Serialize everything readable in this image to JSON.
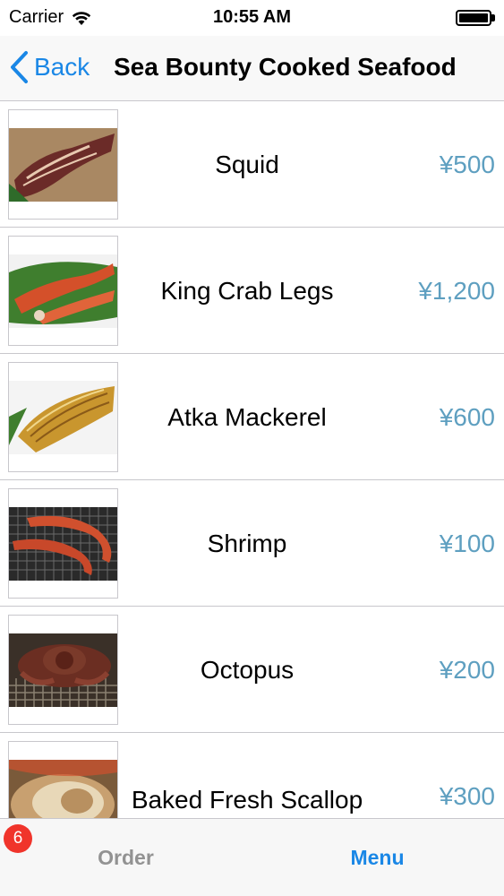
{
  "status_bar": {
    "carrier": "Carrier",
    "time": "10:55 AM"
  },
  "nav": {
    "back_label": "Back",
    "title": "Sea Bounty Cooked Seafood"
  },
  "items": [
    {
      "name": "Squid",
      "price": "¥500",
      "image": "grilled-squid"
    },
    {
      "name": "King Crab Legs",
      "price": "¥1,200",
      "image": "king-crab-legs"
    },
    {
      "name": "Atka Mackerel",
      "price": "¥600",
      "image": "grilled-mackerel"
    },
    {
      "name": "Shrimp",
      "price": "¥100",
      "image": "grilled-shrimp"
    },
    {
      "name": "Octopus",
      "price": "¥200",
      "image": "grilled-octopus"
    },
    {
      "name": "Baked Fresh Scallop",
      "price": "¥300",
      "image": "baked-scallop"
    }
  ],
  "tab_bar": {
    "order_label": "Order",
    "order_badge": "6",
    "menu_label": "Menu"
  },
  "colors": {
    "accent": "#1a87e6",
    "price": "#5e9fc0",
    "badge": "#f0342b"
  }
}
